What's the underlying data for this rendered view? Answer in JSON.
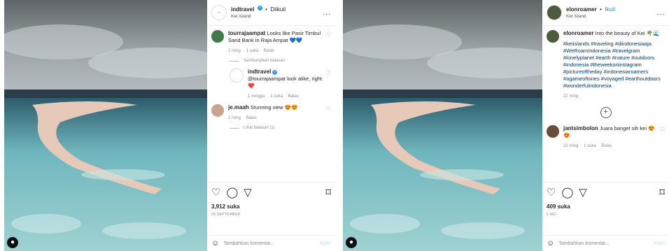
{
  "left_post": {
    "header": {
      "username": "indtravel",
      "verified_icon": "verified-icon",
      "separator": "•",
      "follow_state": "Diikuti",
      "location": "Kei Island",
      "more": "..."
    },
    "comments": [
      {
        "username": "tourrajaampat",
        "text": "Looks like Pasir Timbul Sand Bank in Raja Ampat 💙💙",
        "time": "2 ming",
        "likes": "1 suka",
        "reply": "Balas"
      },
      {
        "thread_toggle": "Sembunyikan balasan"
      },
      {
        "username": "indtravel",
        "text": "@tourrajaampat look alike, right ❤️",
        "time": "1 minggu",
        "likes": "1 suka",
        "reply": "Balas"
      },
      {
        "username": "je.maah",
        "text": "Stunning view 😍😍",
        "time": "2 ming",
        "reply": "Balas"
      },
      {
        "thread_toggle": "Lihat balasan (1)"
      }
    ],
    "likes": "3,912 suka",
    "date": "28 SEPTEMBER",
    "add_comment_placeholder": "Tambahkan komentar...",
    "post_button": "Kirim"
  },
  "right_post": {
    "header": {
      "username": "elonroamer",
      "separator": "•",
      "follow_state": "Ikuti",
      "location": "Kei Island",
      "more": "..."
    },
    "caption": {
      "username": "elonroamer",
      "text": "Into the beauty of Kei 🌴🌊",
      "hashtags": "#keiislands #traveling #diindonesiaaja #WeRoamIndonesia #travelgram #lonelyplanet #earth #nature #outdoors #indonesia #theweekoninstagram #pictureoftheday #indonesiaroamers #agameoftones #voyaged #earthoutdoors #wonderfulindonesia",
      "time": "22 ming"
    },
    "comments": [
      {
        "username": "jantsimbolon",
        "text": "Juara banget sih kei 😍😍",
        "time": "22 ming",
        "likes": "1 suka",
        "reply": "Balas"
      }
    ],
    "likes": "409 suka",
    "date": "6 MEI",
    "add_comment_placeholder": "Tambahkan komentar...",
    "post_button": "Kirim"
  }
}
